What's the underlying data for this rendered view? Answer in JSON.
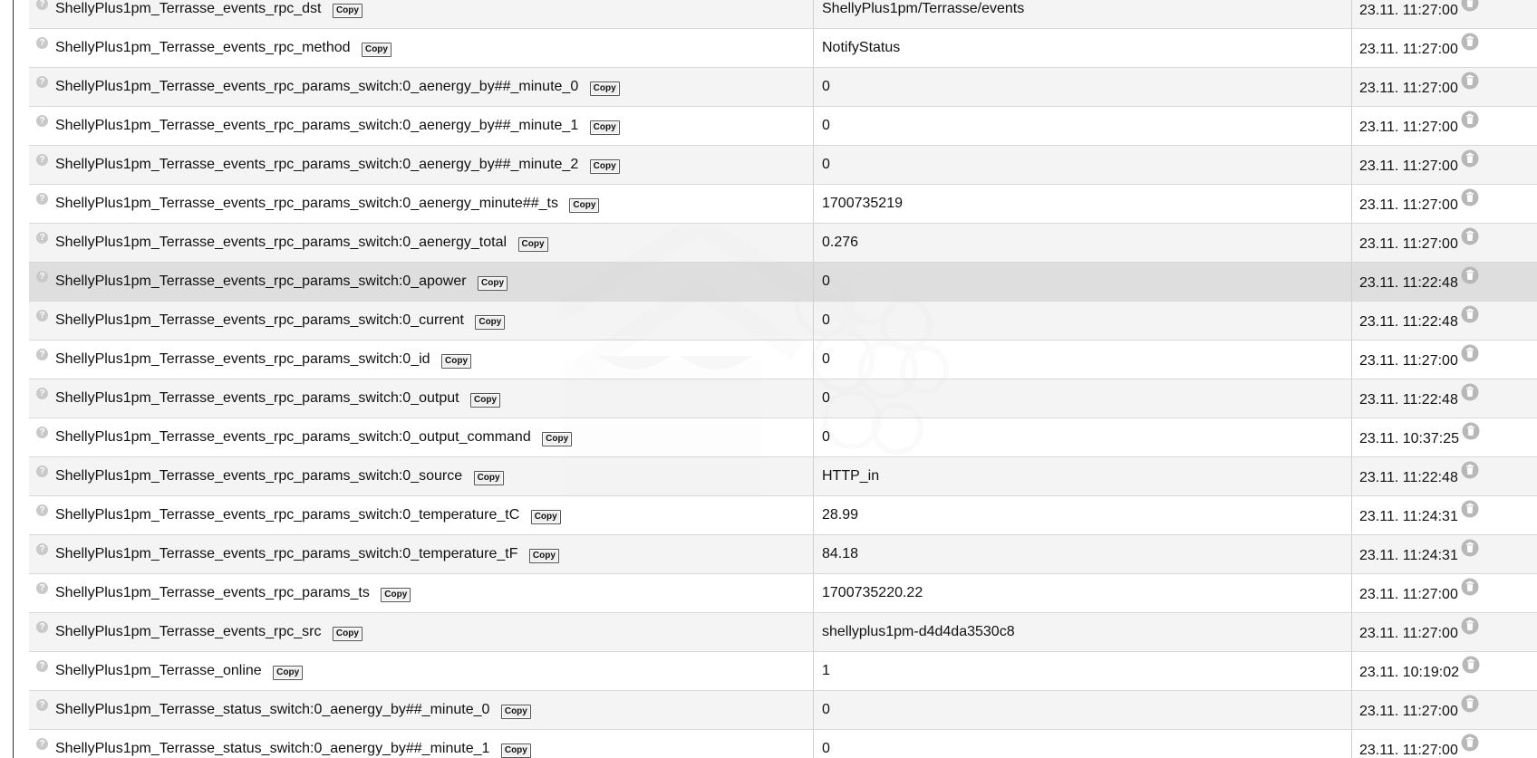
{
  "buttons": {
    "copy_label": "Copy"
  },
  "icons": {
    "help": "help-icon",
    "delete": "trash-icon"
  },
  "colors": {
    "row_odd": "#f3f3f3",
    "row_even": "#ffffff",
    "row_highlight": "#dcdcdc",
    "border": "#d8d8d8"
  },
  "rows": [
    {
      "name": "ShellyPlus1pm_Terrasse_events_rpc_dst",
      "value": "ShellyPlus1pm/Terrasse/events",
      "timestamp": "23.11. 11:27:00"
    },
    {
      "name": "ShellyPlus1pm_Terrasse_events_rpc_method",
      "value": "NotifyStatus",
      "timestamp": "23.11. 11:27:00"
    },
    {
      "name": "ShellyPlus1pm_Terrasse_events_rpc_params_switch:0_aenergy_by##_minute_0",
      "value": "0",
      "timestamp": "23.11. 11:27:00"
    },
    {
      "name": "ShellyPlus1pm_Terrasse_events_rpc_params_switch:0_aenergy_by##_minute_1",
      "value": "0",
      "timestamp": "23.11. 11:27:00"
    },
    {
      "name": "ShellyPlus1pm_Terrasse_events_rpc_params_switch:0_aenergy_by##_minute_2",
      "value": "0",
      "timestamp": "23.11. 11:27:00"
    },
    {
      "name": "ShellyPlus1pm_Terrasse_events_rpc_params_switch:0_aenergy_minute##_ts",
      "value": "1700735219",
      "timestamp": "23.11. 11:27:00"
    },
    {
      "name": "ShellyPlus1pm_Terrasse_events_rpc_params_switch:0_aenergy_total",
      "value": "0.276",
      "timestamp": "23.11. 11:27:00"
    },
    {
      "name": "ShellyPlus1pm_Terrasse_events_rpc_params_switch:0_apower",
      "value": "0",
      "timestamp": "23.11. 11:22:48",
      "highlighted": true
    },
    {
      "name": "ShellyPlus1pm_Terrasse_events_rpc_params_switch:0_current",
      "value": "0",
      "timestamp": "23.11. 11:22:48"
    },
    {
      "name": "ShellyPlus1pm_Terrasse_events_rpc_params_switch:0_id",
      "value": "0",
      "timestamp": "23.11. 11:27:00"
    },
    {
      "name": "ShellyPlus1pm_Terrasse_events_rpc_params_switch:0_output",
      "value": "0",
      "timestamp": "23.11. 11:22:48"
    },
    {
      "name": "ShellyPlus1pm_Terrasse_events_rpc_params_switch:0_output_command",
      "value": "0",
      "timestamp": "23.11. 10:37:25"
    },
    {
      "name": "ShellyPlus1pm_Terrasse_events_rpc_params_switch:0_source",
      "value": "HTTP_in",
      "timestamp": "23.11. 11:22:48"
    },
    {
      "name": "ShellyPlus1pm_Terrasse_events_rpc_params_switch:0_temperature_tC",
      "value": "28.99",
      "timestamp": "23.11. 11:24:31"
    },
    {
      "name": "ShellyPlus1pm_Terrasse_events_rpc_params_switch:0_temperature_tF",
      "value": "84.18",
      "timestamp": "23.11. 11:24:31"
    },
    {
      "name": "ShellyPlus1pm_Terrasse_events_rpc_params_ts",
      "value": "1700735220.22",
      "timestamp": "23.11. 11:27:00"
    },
    {
      "name": "ShellyPlus1pm_Terrasse_events_rpc_src",
      "value": "shellyplus1pm-d4d4da3530c8",
      "timestamp": "23.11. 11:27:00"
    },
    {
      "name": "ShellyPlus1pm_Terrasse_online",
      "value": "1",
      "timestamp": "23.11. 10:19:02"
    },
    {
      "name": "ShellyPlus1pm_Terrasse_status_switch:0_aenergy_by##_minute_0",
      "value": "0",
      "timestamp": "23.11. 11:27:00"
    },
    {
      "name": "ShellyPlus1pm_Terrasse_status_switch:0_aenergy_by##_minute_1",
      "value": "0",
      "timestamp": "23.11. 11:27:00"
    }
  ]
}
